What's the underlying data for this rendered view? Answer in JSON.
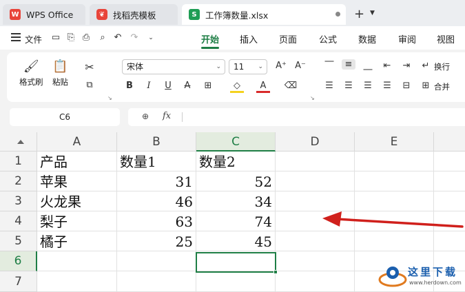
{
  "tabs": [
    {
      "label": "WPS Office",
      "icon": "wps-logo-icon"
    },
    {
      "label": "找稻壳模板",
      "icon": "daoke-logo-icon"
    },
    {
      "label": "工作簿数量.xlsx",
      "icon": "spreadsheet-icon",
      "badge": "S",
      "active": true
    }
  ],
  "menu": {
    "file_label": "文件",
    "items": [
      "开始",
      "插入",
      "页面",
      "公式",
      "数据",
      "审阅",
      "视图"
    ],
    "active": "开始"
  },
  "ribbon": {
    "format_painter": "格式刷",
    "paste": "粘贴",
    "font_name": "宋体",
    "font_size": "11",
    "wrap": "换行",
    "merge": "合并"
  },
  "formula_bar": {
    "name_box": "C6",
    "fx_label": "fx",
    "content": ""
  },
  "sheet": {
    "columns": [
      "A",
      "B",
      "C",
      "D",
      "E"
    ],
    "rows": [
      "1",
      "2",
      "3",
      "4",
      "5",
      "6",
      "7"
    ],
    "header": [
      "产品",
      "数量1",
      "数量2"
    ],
    "data": [
      [
        "苹果",
        "31",
        "52"
      ],
      [
        "火龙果",
        "46",
        "34"
      ],
      [
        "梨子",
        "63",
        "74"
      ],
      [
        "橘子",
        "25",
        "45"
      ]
    ],
    "active_cell": "C6"
  },
  "watermark": {
    "text": "这里下载",
    "url": "www.herdown.com"
  },
  "colors": {
    "accent": "#1e7e45",
    "arrow": "#d0201c"
  }
}
